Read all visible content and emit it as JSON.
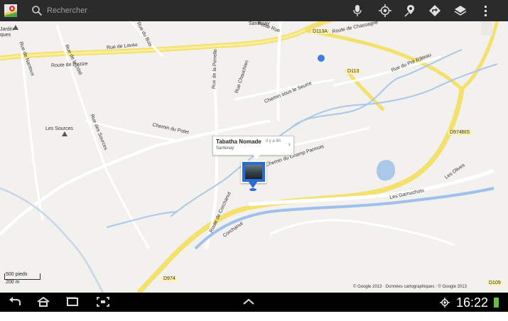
{
  "topbar": {
    "search_placeholder": "Rechercher"
  },
  "map_labels": {
    "jardin": "Jardin",
    "ques": "ques",
    "rue_de_lavau": "Rue de Lavau",
    "route_de_dezize": "Route de Dezize",
    "rue_de_la_dote": "Rue de la Dôté",
    "rue_de_nantoux": "Rue de Nantoux",
    "rue_des_sources": "Rue des Sources",
    "les_sources": "Les Sources",
    "chemin_du_potet": "Chemin du Potet",
    "rue_de_la_perrelle": "Rue de la Perrelle",
    "rue_chauchien": "Rue Chauchien",
    "petite_rue": "Petite Rue",
    "rue_du_bois": "Rue du Bois",
    "santenay_top": "Santenay",
    "d113a": "D113A",
    "route_de_chassagne": "Route de Chassagne",
    "d113": "D113",
    "rue_du_pre_rateau": "Rue du Pré Râteau",
    "chemin_sous_le_seurre": "Chemin sous le Seurre",
    "chemin_du_champ_parmois": "Chemin du Champ Parmois",
    "d974bis": "D974BIS",
    "les_olives": "Les Olives",
    "les_garnuchots": "Les Garnuchots",
    "route_de_corchanut": "Route de Corchanut",
    "corchanut": "Corchanut",
    "d974": "D974",
    "d109": "D109"
  },
  "callout": {
    "title": "Tabatha Nomade",
    "time": "Il y a 6h",
    "place": "Santenay"
  },
  "scale": {
    "feet": "500 pieds",
    "meters": "200 m"
  },
  "attribution": "© Google 2013 · Données cartographiques : © Google 2013",
  "statusbar": {
    "time": "16:22"
  },
  "icons": {
    "maps_app": "maps-app-icon",
    "search": "search-icon",
    "mic": "microphone-icon",
    "location": "my-location-icon",
    "places": "places-icon",
    "directions": "directions-icon",
    "layers": "layers-icon",
    "menu": "overflow-menu-icon",
    "back": "back-icon",
    "home": "home-icon",
    "recent": "recent-apps-icon",
    "screenshot": "screenshot-icon",
    "up": "chevron-up-icon",
    "gps": "gps-status-icon",
    "battery": "battery-icon"
  }
}
